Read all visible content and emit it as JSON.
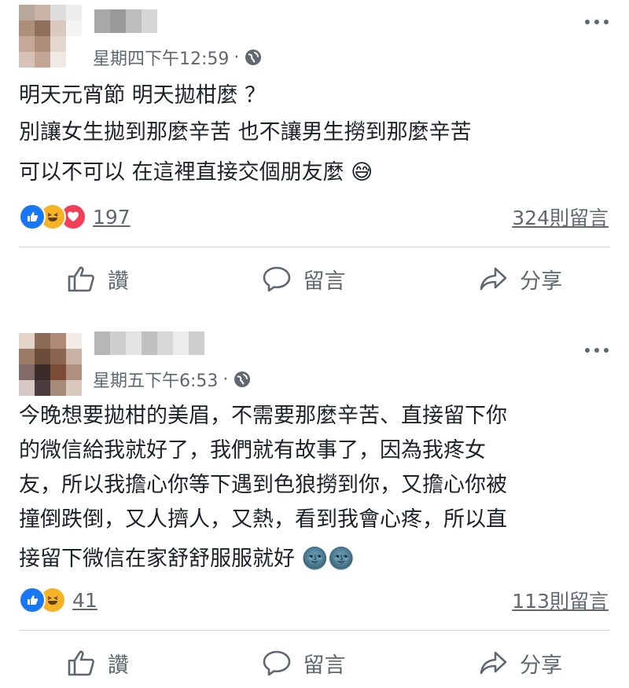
{
  "posts": [
    {
      "timestamp": "星期四下午12:59",
      "separator": "·",
      "privacy_icon": "globe-icon",
      "lines": [
        "明天元宵節 明天拋柑麼 ？",
        "別讓女生拋到那麼辛苦 也不讓男生撈到那麼辛苦",
        "可以不可以 在這裡直接交個朋友麼 😅"
      ],
      "reactions": [
        "like-icon",
        "haha-icon",
        "love-icon"
      ],
      "reaction_count": "197",
      "comment_count": "324則留言",
      "actions": {
        "like": "讚",
        "comment": "留言",
        "share": "分享"
      }
    },
    {
      "timestamp": "星期五下午6:53",
      "separator": "·",
      "privacy_icon": "globe-icon",
      "lines": [
        "今晚想要拋柑的美眉，不需要那麼辛苦、直接留下你",
        "的微信給我就好了，我們就有故事了，因為我疼女",
        "友，所以我擔心你等下遇到色狼撈到你，又擔心你被",
        "撞倒跌倒，又人擠人，又熱，看到我會心疼，所以直",
        "接留下微信在家舒舒服服就好 🌚🌚"
      ],
      "reactions": [
        "like-icon",
        "haha-icon"
      ],
      "reaction_count": "41",
      "comment_count": "113則留言",
      "actions": {
        "like": "讚",
        "comment": "留言",
        "share": "分享"
      }
    }
  ],
  "colors": {
    "text": "#1d2129",
    "secondary": "#606770",
    "like_blue": "#1877f2",
    "love_red": "#f33e58",
    "haha_yellow": "#f7b125",
    "divider": "#dadde1"
  }
}
